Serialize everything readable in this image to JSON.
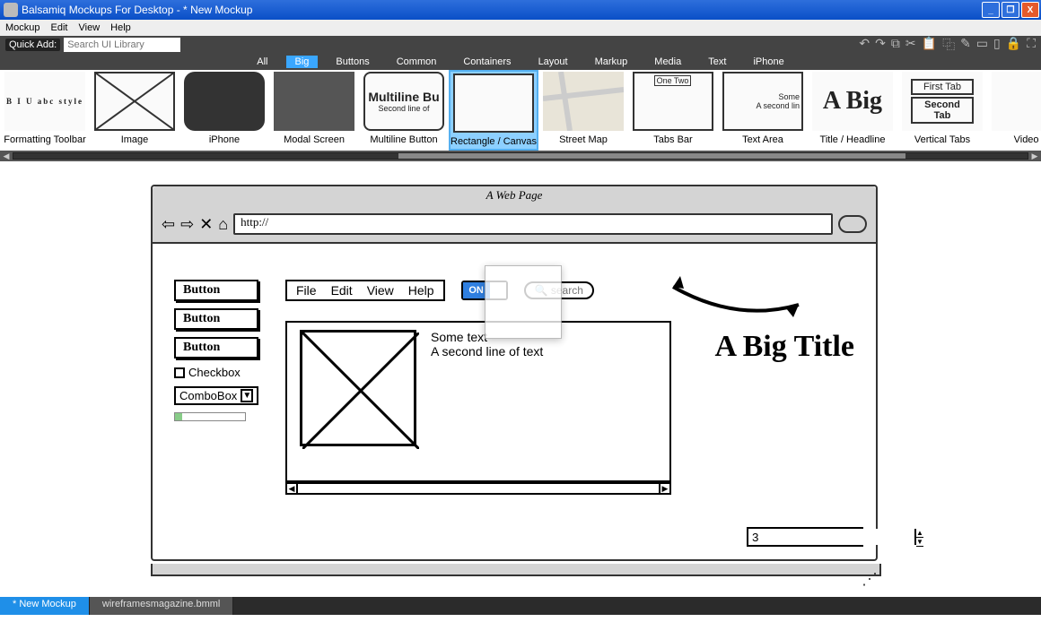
{
  "window": {
    "title": "Balsamiq Mockups For Desktop - * New Mockup"
  },
  "menubar": [
    "Mockup",
    "Edit",
    "View",
    "Help"
  ],
  "toolbar": {
    "quick_add_label": "Quick Add:",
    "search_placeholder": "Search UI Library"
  },
  "category_tabs": [
    "All",
    "Big",
    "Buttons",
    "Common",
    "Containers",
    "Layout",
    "Markup",
    "Media",
    "Text",
    "iPhone"
  ],
  "category_active": "Big",
  "library_items": [
    {
      "name": "Formatting Toolbar",
      "thumb_text": "B I U abc style"
    },
    {
      "name": "Image"
    },
    {
      "name": "iPhone"
    },
    {
      "name": "Modal Screen"
    },
    {
      "name": "Multiline Button",
      "thumb_title": "Multiline Bu",
      "thumb_sub": "Second line of"
    },
    {
      "name": "Rectangle / Canvas",
      "selected": true
    },
    {
      "name": "Street Map"
    },
    {
      "name": "Tabs Bar",
      "thumb_text": "One  Two"
    },
    {
      "name": "Text Area",
      "thumb_title": "Some",
      "thumb_sub": "A second lin"
    },
    {
      "name": "Title / Headline",
      "thumb_text": "A Big"
    },
    {
      "name": "Vertical Tabs",
      "thumb_tab1": "First Tab",
      "thumb_tab2": "Second Tab"
    },
    {
      "name": "Video Pl"
    }
  ],
  "mockup": {
    "browser_title": "A Web Page",
    "url": "http://",
    "buttons": [
      "Button",
      "Button",
      "Button"
    ],
    "checkbox_label": "Checkbox",
    "combobox_label": "ComboBox",
    "menu_items": [
      "File",
      "Edit",
      "View",
      "Help"
    ],
    "toggle_on": "ON",
    "search_placeholder": "search",
    "textarea_line1": "Some text",
    "textarea_line2": "A second line of text",
    "headline": "A Big Title",
    "stepper_value": "3"
  },
  "doc_tabs": {
    "active": "* New Mockup",
    "other": "wireframesmagazine.bmml"
  }
}
